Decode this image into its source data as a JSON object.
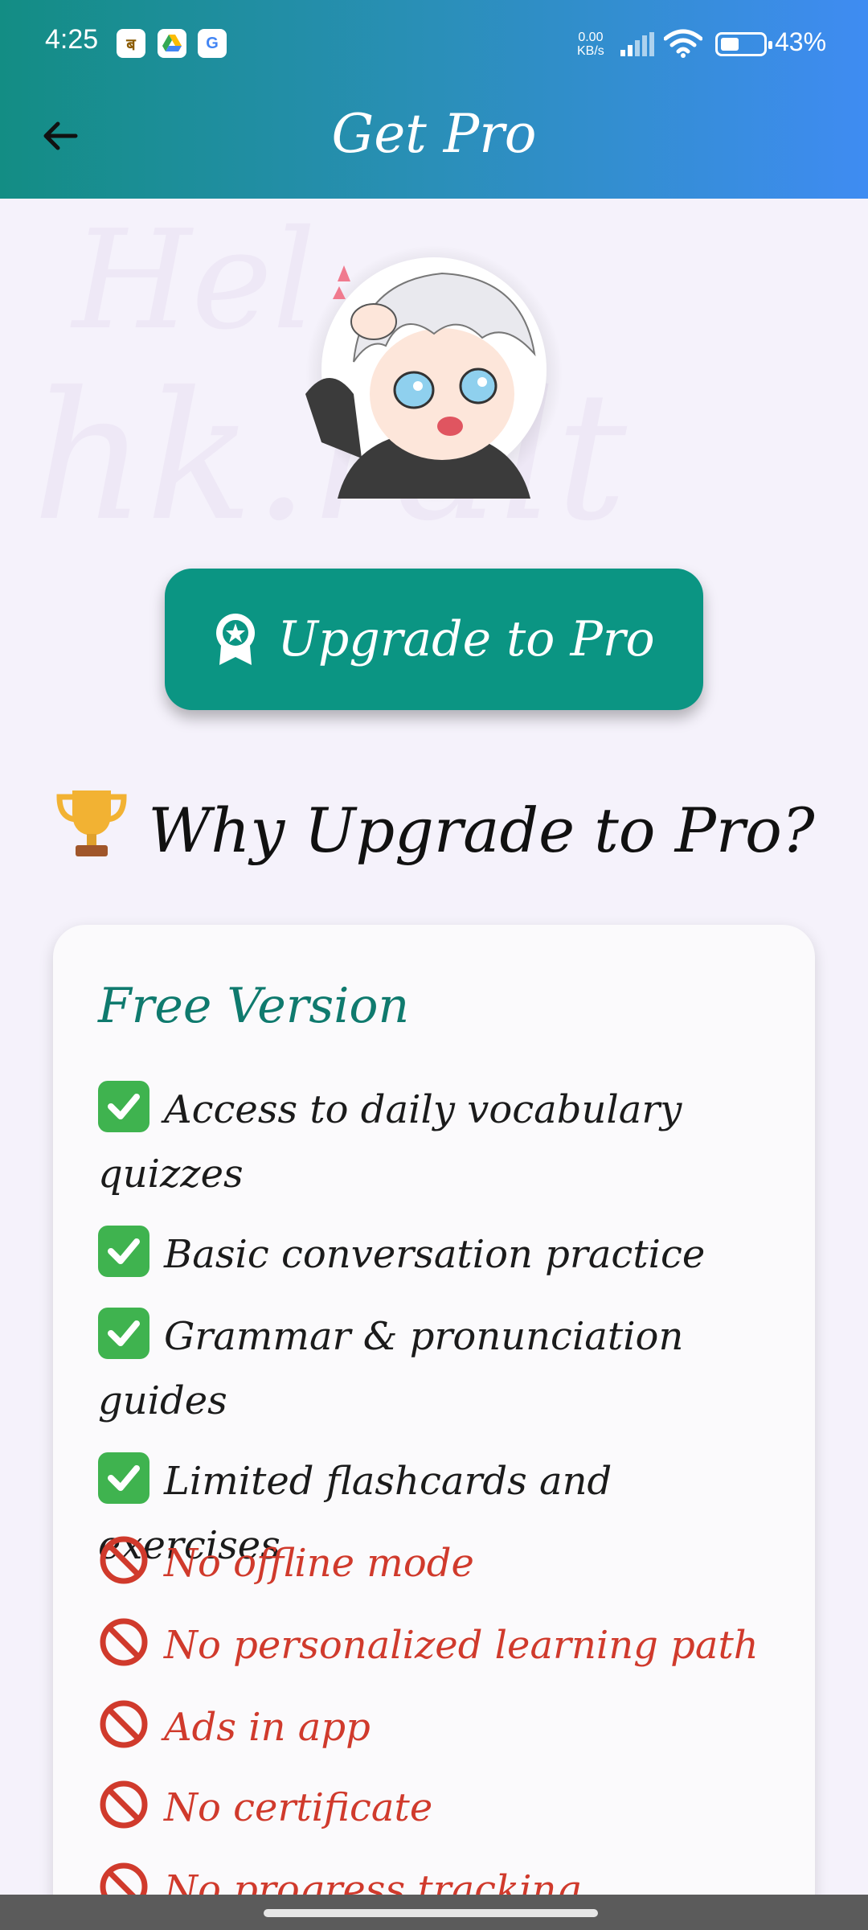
{
  "status_bar": {
    "time": "4:25",
    "notif_icons": [
      "app-icon-hindi",
      "drive-icon",
      "google-icon"
    ],
    "net_speed_value": "0.00",
    "net_speed_unit": "KB/s",
    "battery": "43%"
  },
  "header": {
    "title": "Get Pro",
    "back_icon": "arrow-left-icon"
  },
  "upgrade_button": {
    "label": "Upgrade to Pro",
    "icon": "badge-star-icon",
    "color": "#0b9583"
  },
  "why_heading": {
    "label": "Why Upgrade to Pro?",
    "icon": "trophy-icon"
  },
  "free_card": {
    "title": "Free Version",
    "included": [
      "Access to daily vocabulary quizzes",
      "Basic conversation practice",
      "Grammar & pronunciation guides",
      "Limited flashcards and exercises"
    ],
    "excluded": [
      "No offline mode",
      "No personalized learning path",
      "Ads in app",
      "No certificate",
      "No progress tracking"
    ]
  },
  "colors": {
    "header_start": "#138d84",
    "header_end": "#3f8cf2",
    "accent": "#0f7a6e",
    "negative": "#d03a2c",
    "check": "#3fb34f"
  }
}
